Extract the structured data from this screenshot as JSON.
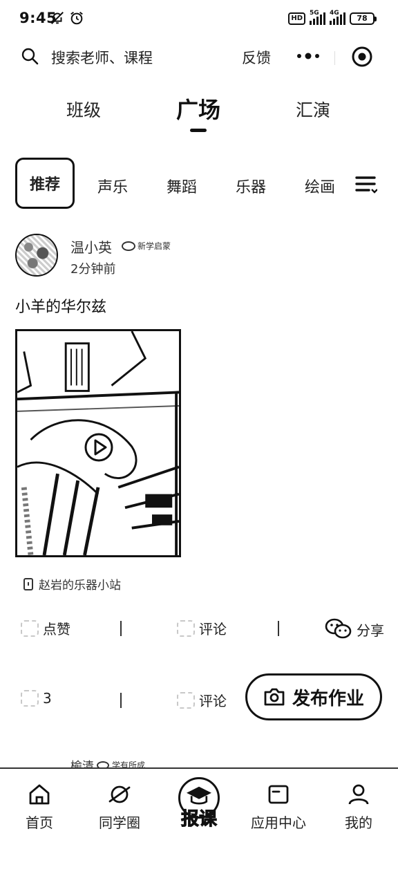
{
  "status_bar": {
    "time": "9:45",
    "hd": "HD",
    "net1": "5G",
    "net2": "4G",
    "battery": "78"
  },
  "header": {
    "search_placeholder": "搜索老师、课程",
    "feedback_label": "反馈"
  },
  "main_tabs": [
    {
      "label": "班级"
    },
    {
      "label": "广场"
    },
    {
      "label": "汇演"
    }
  ],
  "categories": [
    {
      "label": "推荐"
    },
    {
      "label": "声乐"
    },
    {
      "label": "舞蹈"
    },
    {
      "label": "乐器"
    },
    {
      "label": "绘画"
    }
  ],
  "post": {
    "author": "温小英",
    "badge": "新学启蒙",
    "time": "2分钟前",
    "title": "小羊的华尔兹",
    "channel": "赵岩的乐器小站"
  },
  "actions_1": {
    "like": "点赞",
    "comment": "评论",
    "share": "分享"
  },
  "actions_2": {
    "like_count": "3",
    "comment": "评论"
  },
  "publish_button": "发布作业",
  "next_post": {
    "author": "榆清",
    "badge": "学有所成"
  },
  "bottom_nav": {
    "home": "首页",
    "circle": "同学圈",
    "center": "报课",
    "apps": "应用中心",
    "me": "我的"
  }
}
